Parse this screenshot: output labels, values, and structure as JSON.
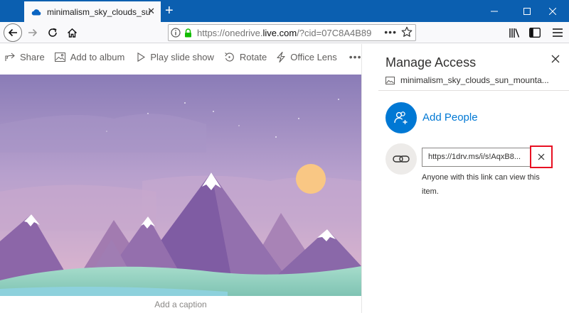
{
  "browser": {
    "tab_title": "minimalism_sky_clouds_sun_m",
    "new_tab_symbol": "+",
    "url_prefix": "https://onedrive.",
    "url_domain": "live.com",
    "url_suffix": "/?cid=07C8A4B89",
    "url_more": "•••",
    "window_controls": [
      "minimize",
      "maximize",
      "close"
    ]
  },
  "toolbar": {
    "share": "Share",
    "add_to_album": "Add to album",
    "play_slide_show": "Play slide show",
    "rotate": "Rotate",
    "office_lens": "Office Lens",
    "more": "•••"
  },
  "image": {
    "caption_placeholder": "Add a caption",
    "palette": {
      "sky_top": "#8d7eb8",
      "sky_mid": "#b79fcc",
      "sky_bottom": "#dcb6cf",
      "sun": "#f9c784",
      "mountain_dark": "#7b5aa0",
      "mountain_mid": "#9a72ad",
      "snow": "#ffffff",
      "hills": "#9ed9c6"
    }
  },
  "panel": {
    "title": "Manage Access",
    "file_name": "minimalism_sky_clouds_sun_mounta...",
    "add_people": "Add People",
    "link_value": "https://1drv.ms/i/s!AqxB8...",
    "link_description": "Anyone with this link can view this item.",
    "accent_color": "#0078d4",
    "highlight_color": "#e81123"
  },
  "icons": [
    "onedrive-cloud-icon",
    "back-arrow-icon",
    "forward-arrow-icon",
    "reload-icon",
    "home-icon",
    "info-icon",
    "lock-icon",
    "star-icon",
    "library-icon",
    "sidebar-icon",
    "menu-icon",
    "share-icon",
    "album-icon",
    "play-icon",
    "rotate-icon",
    "office-lens-icon",
    "close-icon",
    "image-file-icon",
    "add-people-icon",
    "link-icon",
    "remove-link-icon"
  ]
}
